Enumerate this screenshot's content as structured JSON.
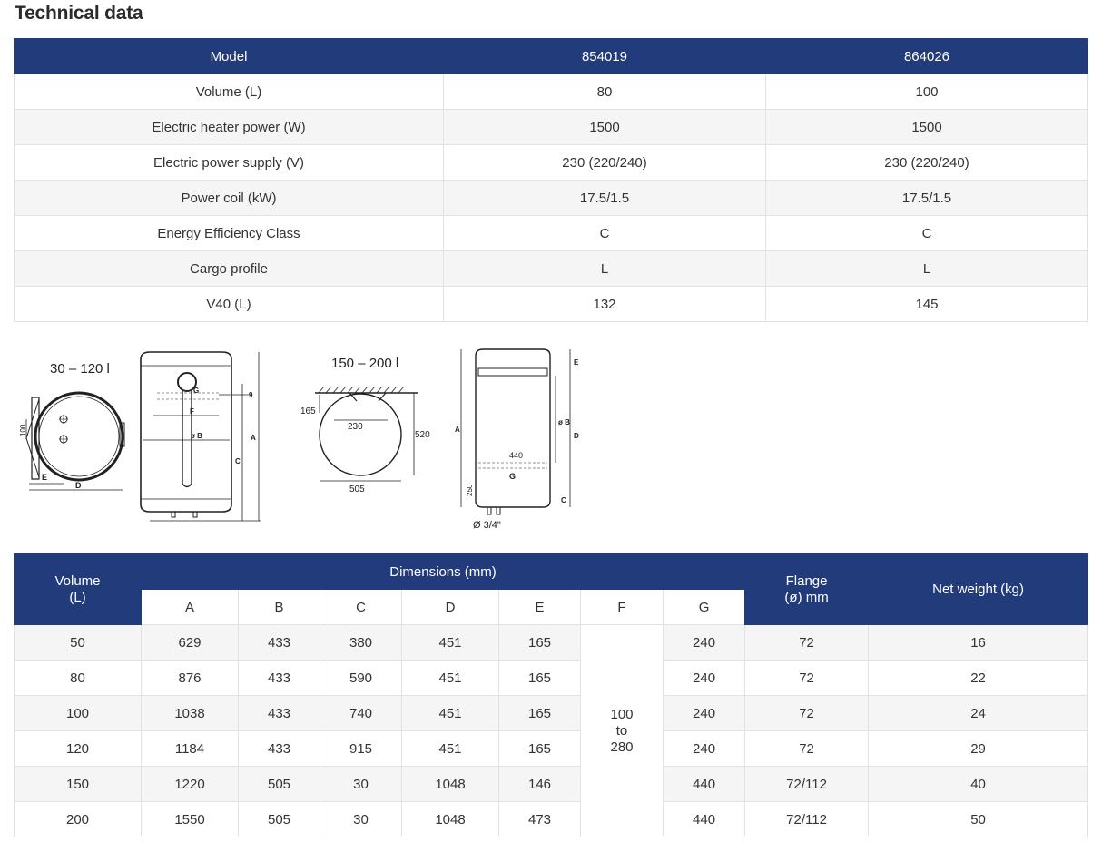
{
  "page": {
    "title": "Technical data"
  },
  "spec_table": {
    "headers": [
      "Model",
      "854019",
      "864026"
    ],
    "rows": [
      [
        "Volume (L)",
        "80",
        "100"
      ],
      [
        "Electric heater power (W)",
        "1500",
        "1500"
      ],
      [
        "Electric power supply (V)",
        "230 (220/240)",
        "230 (220/240)"
      ],
      [
        "Power coil (kW)",
        "17.5/1.5",
        "17.5/1.5"
      ],
      [
        "Energy Efficiency Class",
        "C",
        "C"
      ],
      [
        "Cargo profile",
        "L",
        "L"
      ],
      [
        "V40 (L)",
        "132",
        "145"
      ]
    ]
  },
  "diagram_labels": {
    "range1": "30 – 120 l",
    "range2": "150 – 200 l",
    "d100": "100",
    "dE": "E",
    "dD": "D",
    "dG": "G",
    "dF": "F",
    "dB": "ø B",
    "d9": "9",
    "dA": "A",
    "dC": "C",
    "d165": "165",
    "d230": "230",
    "d520": "520",
    "d505": "505",
    "d440": "440",
    "d250": "250",
    "d34": "Ø 3/4\""
  },
  "dim_table": {
    "volume_header": "Volume (L)",
    "dimensions_header": "Dimensions (mm)",
    "flange_header": "Flange (ø) mm",
    "weight_header": "Net weight (kg)",
    "sub_headers": [
      "A",
      "B",
      "C",
      "D",
      "E",
      "F",
      "G"
    ],
    "f_value": "100 to 280",
    "rows": [
      [
        "50",
        "629",
        "433",
        "380",
        "451",
        "165",
        "240",
        "72",
        "16"
      ],
      [
        "80",
        "876",
        "433",
        "590",
        "451",
        "165",
        "240",
        "72",
        "22"
      ],
      [
        "100",
        "1038",
        "433",
        "740",
        "451",
        "165",
        "240",
        "72",
        "24"
      ],
      [
        "120",
        "1184",
        "433",
        "915",
        "451",
        "165",
        "240",
        "72",
        "29"
      ],
      [
        "150",
        "1220",
        "505",
        "30",
        "1048",
        "146",
        "440",
        "72/112",
        "40"
      ],
      [
        "200",
        "1550",
        "505",
        "30",
        "1048",
        "473",
        "440",
        "72/112",
        "50"
      ]
    ]
  }
}
